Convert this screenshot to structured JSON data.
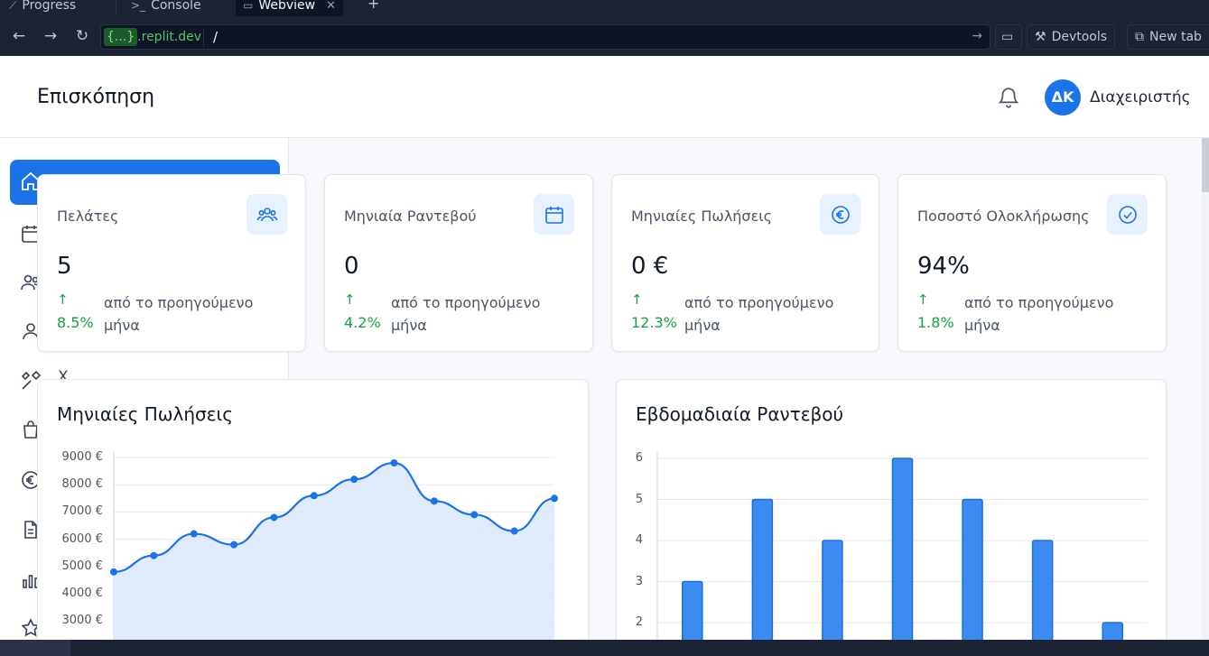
{
  "ide": {
    "tabs": [
      {
        "label": "Progress"
      },
      {
        "label": "Console"
      },
      {
        "label": "Webview"
      }
    ],
    "url_host_brace": "{...}",
    "url_host": ".replit.dev",
    "url_path": "/",
    "devtools_label": "Devtools",
    "newtab_label": "New tab"
  },
  "header": {
    "title": "Επισκόπηση",
    "avatar_initials": "ΔΚ",
    "user_name": "Διαχειριστής"
  },
  "sidebar": {
    "items": [
      {
        "icon": "home-icon"
      },
      {
        "icon": "calendar-icon"
      },
      {
        "icon": "users-icon"
      },
      {
        "icon": "user-icon"
      },
      {
        "icon": "tools-icon",
        "label": "Χ"
      },
      {
        "icon": "bag-icon"
      },
      {
        "icon": "euro-icon"
      },
      {
        "icon": "document-icon"
      },
      {
        "icon": "bar-chart-icon"
      },
      {
        "icon": "star-icon"
      }
    ]
  },
  "stats": [
    {
      "title": "Πελάτες",
      "value": "5",
      "arrow": "↑",
      "pct": "8.5%",
      "desc": "από το προηγούμενο μήνα",
      "icon": "users-icon"
    },
    {
      "title": "Μηνιαία Ραντεβού",
      "value": "0",
      "arrow": "↑",
      "pct": "4.2%",
      "desc": "από το προηγούμενο μήνα",
      "icon": "calendar-icon"
    },
    {
      "title": "Μηνιαίες Πωλήσεις",
      "value": "0 €",
      "arrow": "↑",
      "pct": "12.3%",
      "desc": "από το προηγούμενο μήνα",
      "icon": "euro-icon"
    },
    {
      "title": "Ποσοστό Ολοκλήρωσης",
      "value": "94%",
      "arrow": "↑",
      "pct": "1.8%",
      "desc": "από το προηγούμενο μήνα",
      "icon": "check-circle-icon"
    }
  ],
  "charts": {
    "sales_title": "Μηνιαίες Πωλήσεις",
    "appointments_title": "Εβδομαδιαία Ραντεβού"
  },
  "chart_data": [
    {
      "type": "area",
      "title": "Μηνιαίες Πωλήσεις",
      "y_tick_labels": [
        "9000 €",
        "8000 €",
        "7000 €",
        "6000 €",
        "5000 €",
        "4000 €",
        "3000 €"
      ],
      "y_ticks": [
        9000,
        8000,
        7000,
        6000,
        5000,
        4000,
        3000
      ],
      "x": [
        1,
        2,
        3,
        4,
        5,
        6,
        7,
        8,
        9,
        10,
        11,
        12
      ],
      "values": [
        4800,
        5400,
        6200,
        5800,
        6800,
        7600,
        8200,
        8800,
        7400,
        6900,
        6300,
        7500
      ],
      "ylim": [
        2000,
        9000
      ],
      "grid": true,
      "color": "#1a73e8"
    },
    {
      "type": "bar",
      "title": "Εβδομαδιαία Ραντεβού",
      "y_ticks": [
        6,
        5,
        4,
        3,
        2
      ],
      "values": [
        3,
        5,
        4,
        6,
        5,
        4,
        2
      ],
      "ylim": [
        0,
        6
      ],
      "grid": true,
      "color": "#3b8bf0"
    }
  ]
}
